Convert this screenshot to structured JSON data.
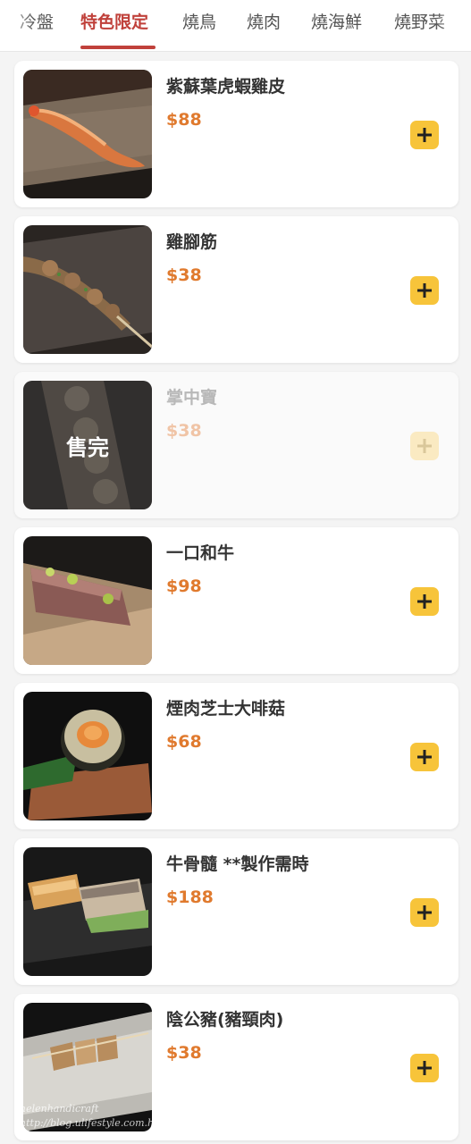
{
  "tabs": [
    {
      "label": "冷盤",
      "active": false
    },
    {
      "label": "特色限定",
      "active": true
    },
    {
      "label": "燒鳥",
      "active": false
    },
    {
      "label": "燒肉",
      "active": false
    },
    {
      "label": "燒海鮮",
      "active": false
    },
    {
      "label": "燒野菜",
      "active": false
    }
  ],
  "items": [
    {
      "name": "紫蘇葉虎蝦雞皮",
      "price": "$88",
      "sold_out": false
    },
    {
      "name": "雞腳筋",
      "price": "$38",
      "sold_out": false
    },
    {
      "name": "掌中寶",
      "price": "$38",
      "sold_out": true,
      "sold_out_label": "售完"
    },
    {
      "name": "一口和牛",
      "price": "$98",
      "sold_out": false
    },
    {
      "name": "煙肉芝士大啡菇",
      "price": "$68",
      "sold_out": false
    },
    {
      "name": "牛骨髓 **製作需時",
      "price": "$188",
      "sold_out": false
    },
    {
      "name": "陰公豬(豬頸肉)",
      "price": "$38",
      "sold_out": false
    }
  ],
  "watermark": {
    "line1": "helenhandicraft",
    "line2": "http://blog.ulifestyle.com.hk/"
  },
  "colors": {
    "accent": "#c0413b",
    "price": "#e07a2e",
    "add_button": "#f7c43a"
  },
  "icons": {
    "add": "plus-icon"
  }
}
